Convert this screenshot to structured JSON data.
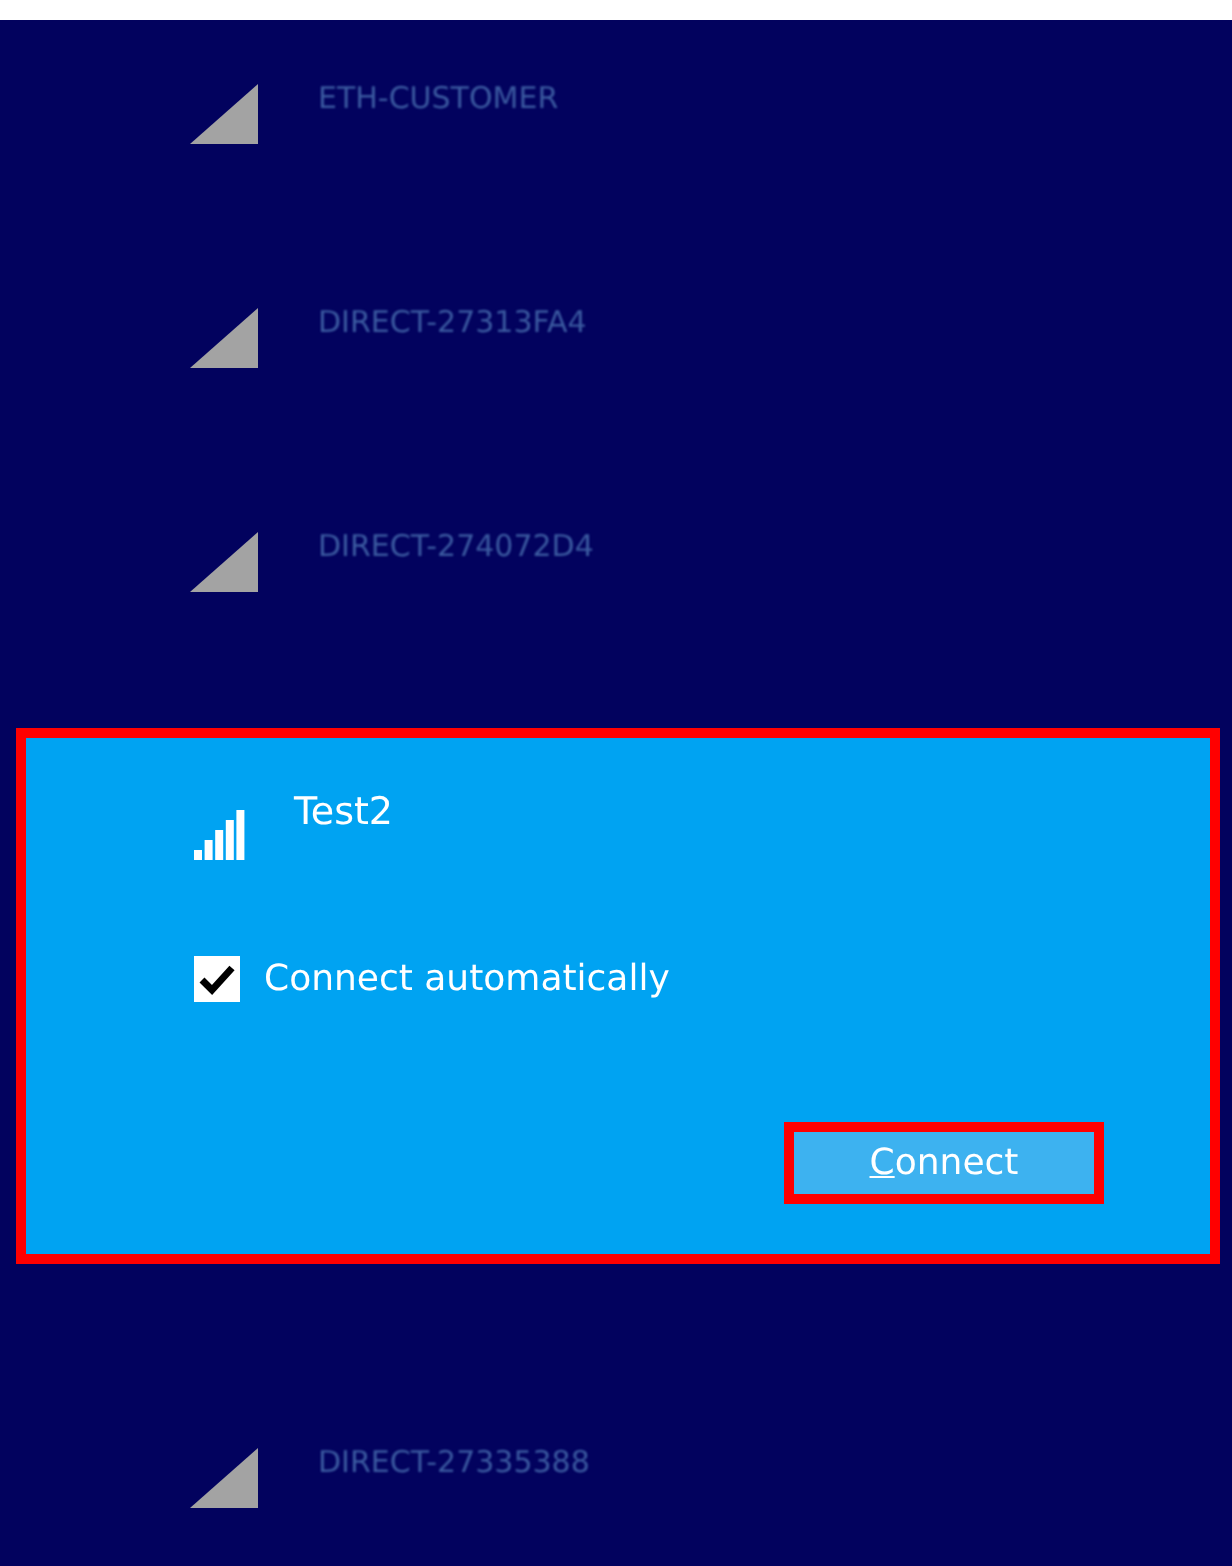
{
  "networks": [
    {
      "name": "ETH-CUSTOMER",
      "selected": false
    },
    {
      "name": "DIRECT-27313FA4",
      "selected": false
    },
    {
      "name": "DIRECT-274072D4",
      "selected": false
    },
    {
      "name": "Test2",
      "selected": true,
      "highlighted": true,
      "auto_connect": {
        "label": "Connect automatically",
        "checked": true
      },
      "connect_button": {
        "label": "Connect",
        "first_letter_underlined": true,
        "highlighted": true
      }
    },
    {
      "name": "DIRECT-27335388",
      "selected": false
    }
  ]
}
